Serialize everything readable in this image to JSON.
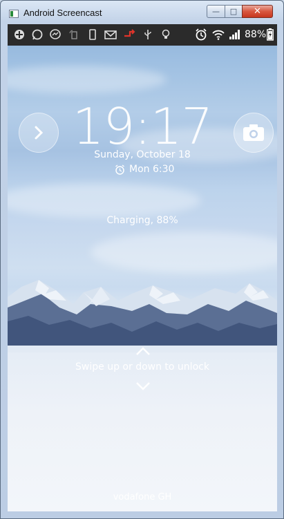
{
  "window": {
    "title": "Android Screencast",
    "minimize": "—",
    "maximize": "□",
    "close": "✕"
  },
  "statusbar": {
    "left_icons": [
      "add-icon",
      "whatsapp-icon",
      "messenger-icon",
      "rotate-icon",
      "phone-icon",
      "gmail-icon",
      "transfer-icon",
      "usb-icon",
      "bulb-icon"
    ],
    "right_icons": [
      "alarm-icon",
      "wifi-icon",
      "signal-icon",
      "battery-icon"
    ],
    "battery_percent": "88%"
  },
  "lockscreen": {
    "time": "19:17",
    "date": "Sunday, October 18",
    "alarm": "Mon 6:30",
    "charging": "Charging, 88%",
    "swipe_hint": "Swipe up or down to unlock",
    "carrier": "vodafone GH",
    "left_shortcut_icon": "chevron-right-icon",
    "right_shortcut_icon": "camera-icon"
  },
  "colors": {
    "titlebar": "#c3d3e8",
    "close_button": "#d8573f",
    "statusbar": "#2b2b2b"
  }
}
